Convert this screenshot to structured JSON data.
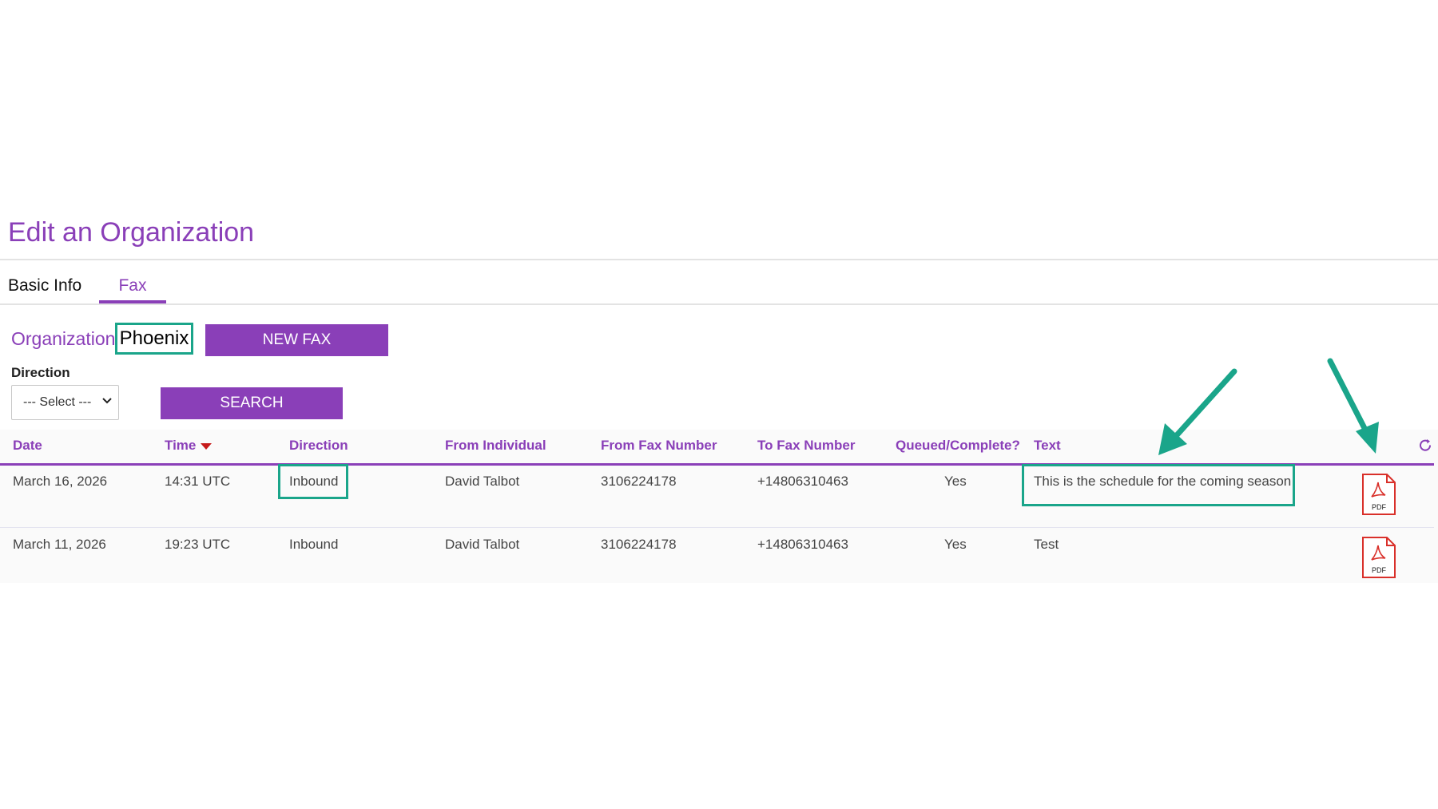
{
  "header": {
    "title": "Edit an Organization"
  },
  "tabs": [
    {
      "label": "Basic Info",
      "active": false
    },
    {
      "label": "Fax",
      "active": true
    }
  ],
  "organization": {
    "label": "Organization",
    "value": "Phoenix"
  },
  "buttons": {
    "new_fax": "NEW FAX",
    "search": "SEARCH"
  },
  "filters": {
    "direction_label": "Direction",
    "direction_selected": "--- Select ---"
  },
  "table": {
    "columns": [
      "Date",
      "Time",
      "Direction",
      "From Individual",
      "From Fax Number",
      "To Fax Number",
      "Queued/Complete?",
      "Text"
    ],
    "sort_column": "Time",
    "rows": [
      {
        "date": "March 16, 2026",
        "time": "14:31 UTC",
        "direction": "Inbound",
        "from_individual": "David Talbot",
        "from_fax": "3106224178",
        "to_fax": "+14806310463",
        "queued": "Yes",
        "text": "This is the schedule for the coming season",
        "attachment_label": "PDF"
      },
      {
        "date": "March 11, 2026",
        "time": "19:23 UTC",
        "direction": "Inbound",
        "from_individual": "David Talbot",
        "from_fax": "3106224178",
        "to_fax": "+14806310463",
        "queued": "Yes",
        "text": "Test",
        "attachment_label": "PDF"
      }
    ]
  },
  "icons": {
    "pdf": "pdf-file-icon",
    "refresh": "refresh-icon",
    "sort": "sort-desc-icon",
    "dropdown": "chevron-down-icon"
  },
  "colors": {
    "accent": "#8a3fb8",
    "highlight": "#1aa58a",
    "pdf_red": "#d9302a",
    "sort_red": "#c61b1b"
  }
}
